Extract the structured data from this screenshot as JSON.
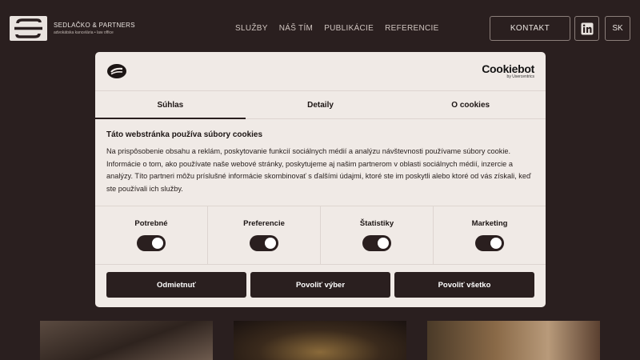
{
  "header": {
    "logo_name": "SEDLAČKO & PARTNERS",
    "logo_sub": "advokátska kancelária • law office",
    "nav": [
      "SLUŽBY",
      "NÁŠ TÍM",
      "PUBLIKÁCIE",
      "REFERENCIE"
    ],
    "contact_label": "KONTAKT",
    "linkedin_icon": "linkedin-icon",
    "lang_label": "SK"
  },
  "dialog": {
    "brand_name": "Cookiebot",
    "brand_by": "by Usercentrics",
    "tabs": [
      "Súhlas",
      "Detaily",
      "O cookies"
    ],
    "active_tab": "Súhlas",
    "heading": "Táto webstránka používa súbory cookies",
    "text": "Na prispôsobenie obsahu a reklám, poskytovanie funkcií sociálnych médií a analýzu návštevnosti používame súbory cookie. Informácie o tom, ako používate naše webové stránky, poskytujeme aj našim partnerom v oblasti sociálnych médií, inzercie a analýzy. Títo partneri môžu príslušné informácie skombinovať s ďalšími údajmi, ktoré ste im poskytli alebo ktoré od vás získali, keď ste používali ich služby.",
    "consents": [
      {
        "label": "Potrebné",
        "on": true
      },
      {
        "label": "Preferencie",
        "on": true
      },
      {
        "label": "Štatistiky",
        "on": true
      },
      {
        "label": "Marketing",
        "on": true
      }
    ],
    "buttons": {
      "reject": "Odmietnuť",
      "allow_selection": "Povoliť výber",
      "allow_all": "Povoliť všetko"
    }
  },
  "colors": {
    "page_bg": "#2a1f1f",
    "dialog_bg": "#f0eae6",
    "button_bg": "#2a1f1f"
  }
}
